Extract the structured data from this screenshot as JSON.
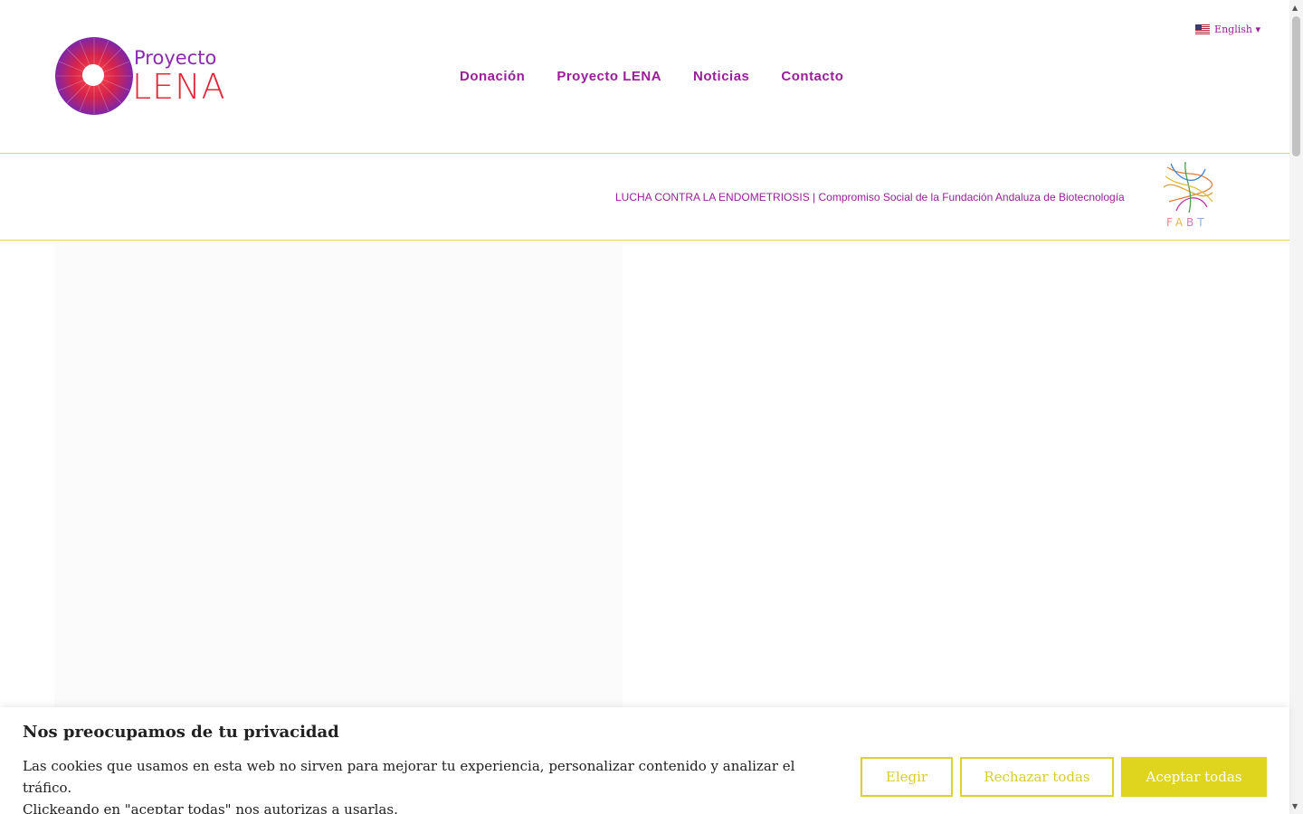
{
  "header": {
    "logo": {
      "line1": "Proyecto",
      "line2": "LENA"
    },
    "nav": [
      {
        "label": "Donación"
      },
      {
        "label": "Proyecto LENA"
      },
      {
        "label": "Noticias"
      },
      {
        "label": "Contacto"
      }
    ],
    "language": {
      "label": "English ▾"
    }
  },
  "banner": {
    "tagline": "LUCHA CONTRA LA ENDOMETRIOSIS | Compromiso Social de la Fundación Andaluza de Biotecnología",
    "partner_logo": "FABT"
  },
  "cookie": {
    "title": "Nos preocupamos de tu privacidad",
    "body_line1": "Las cookies que usamos en esta web no sirven para mejorar tu experiencia, personalizar contenido y analizar el tráfico.",
    "body_line2": "Clickeando en \"aceptar todas\" nos autorizas a usarlas.",
    "buttons": {
      "choose": "Elegir",
      "reject": "Rechazar todas",
      "accept": "Aceptar todas"
    }
  },
  "colors": {
    "brand_purple": "#9a1e9a",
    "brand_red": "#e22838",
    "accent_yellow": "#dfd51f"
  }
}
